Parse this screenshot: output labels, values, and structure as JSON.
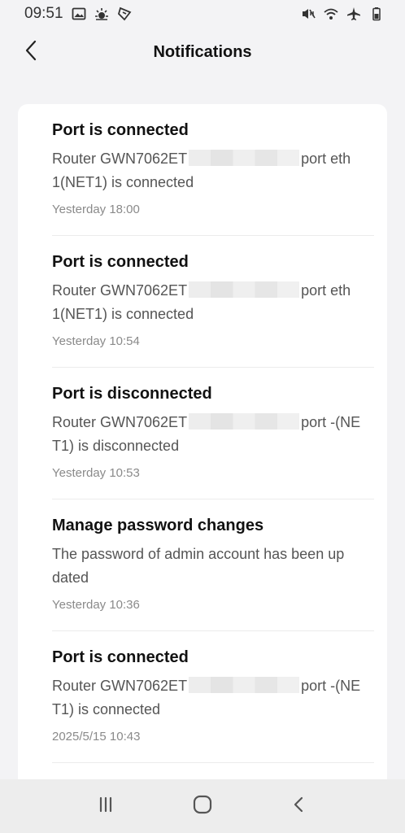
{
  "status_bar": {
    "time": "09:51",
    "left_icons": [
      "gallery-icon",
      "weather-icon",
      "app-icon"
    ],
    "right_icons": [
      "mute-vibrate-icon",
      "wifi-icon",
      "airplane-icon",
      "battery-icon"
    ]
  },
  "header": {
    "title": "Notifications",
    "back_icon": "chevron-left-icon"
  },
  "notifications": [
    {
      "title": "Port is connected",
      "msg_before": "Router GWN7062ET",
      "msg_after": "port eth 1(NET1) is connected",
      "time": "Yesterday 18:00"
    },
    {
      "title": "Port is connected",
      "msg_before": "Router GWN7062ET",
      "msg_after": "port eth 1(NET1) is connected",
      "time": "Yesterday 10:54"
    },
    {
      "title": "Port is disconnected",
      "msg_before": "Router GWN7062ET",
      "msg_after": "port -(NE T1) is disconnected",
      "time": "Yesterday 10:53"
    },
    {
      "title": "Manage password changes",
      "msg_before": "The password of admin account has been up dated",
      "msg_after": "",
      "time": "Yesterday 10:36"
    },
    {
      "title": "Port is connected",
      "msg_before": "Router GWN7062ET",
      "msg_after": "port -(NE T1) is connected",
      "time": "2025/5/15 10:43"
    }
  ],
  "nav_bar": {
    "icons": [
      "recent-apps-icon",
      "home-icon",
      "back-icon"
    ]
  },
  "colors": {
    "background": "#f3f3f5",
    "card": "#ffffff",
    "nav_bar": "#ededed"
  }
}
